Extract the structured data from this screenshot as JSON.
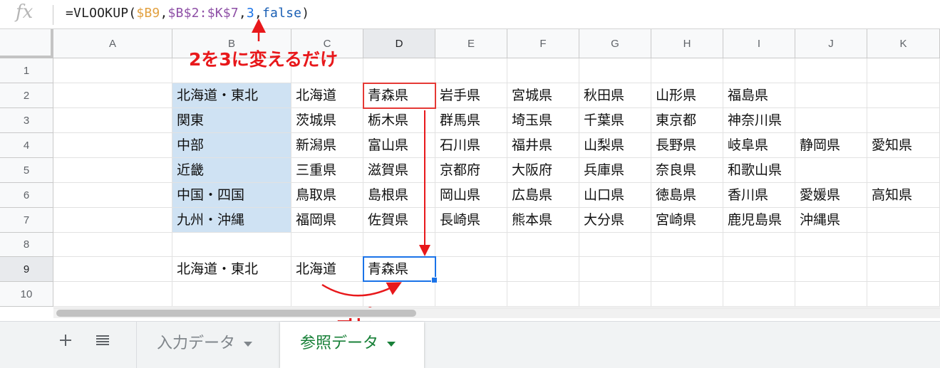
{
  "formula_bar": {
    "fx_icon": "fx",
    "formula_parts": [
      {
        "text": "=VLOOKUP(",
        "color": "#222222"
      },
      {
        "text": "$B9",
        "color": "#e2a03f"
      },
      {
        "text": ",",
        "color": "#222222"
      },
      {
        "text": "$B$2:$K$7",
        "color": "#8e4fa6"
      },
      {
        "text": ",",
        "color": "#222222"
      },
      {
        "text": "3",
        "color": "#1a73e8"
      },
      {
        "text": ",",
        "color": "#222222"
      },
      {
        "text": "false",
        "color": "#1a5fb4"
      },
      {
        "text": ")",
        "color": "#222222"
      }
    ]
  },
  "columns": [
    "A",
    "B",
    "C",
    "D",
    "E",
    "F",
    "G",
    "H",
    "I",
    "J",
    "K"
  ],
  "selected_column": "D",
  "rows": [
    "1",
    "2",
    "3",
    "4",
    "5",
    "6",
    "7",
    "8",
    "9",
    "10"
  ],
  "selected_row": "9",
  "cells": {
    "r2": [
      "",
      "北海道・東北",
      "北海道",
      "青森県",
      "岩手県",
      "宮城県",
      "秋田県",
      "山形県",
      "福島県",
      "",
      ""
    ],
    "r3": [
      "",
      "関東",
      "茨城県",
      "栃木県",
      "群馬県",
      "埼玉県",
      "千葉県",
      "東京都",
      "神奈川県",
      "",
      ""
    ],
    "r4": [
      "",
      "中部",
      "新潟県",
      "富山県",
      "石川県",
      "福井県",
      "山梨県",
      "長野県",
      "岐阜県",
      "静岡県",
      "愛知県"
    ],
    "r5": [
      "",
      "近畿",
      "三重県",
      "滋賀県",
      "京都府",
      "大阪府",
      "兵庫県",
      "奈良県",
      "和歌山県",
      "",
      ""
    ],
    "r6": [
      "",
      "中国・四国",
      "鳥取県",
      "島根県",
      "岡山県",
      "広島県",
      "山口県",
      "徳島県",
      "香川県",
      "愛媛県",
      "高知県"
    ],
    "r7": [
      "",
      "九州・沖縄",
      "福岡県",
      "佐賀県",
      "長崎県",
      "熊本県",
      "大分県",
      "宮崎県",
      "鹿児島県",
      "沖縄県",
      ""
    ],
    "r9": [
      "",
      "北海道・東北",
      "北海道",
      "青森県",
      "",
      "",
      "",
      "",
      "",
      "",
      ""
    ]
  },
  "annotations": {
    "change_note": "2を3に変えるだけ",
    "copy_note": "コピー",
    "accent_color": "#e8181b"
  },
  "sheet_tabs": {
    "add_icon": "plus-icon",
    "list_icon": "list-icon",
    "tabs": [
      {
        "label": "入力データ",
        "active": false
      },
      {
        "label": "参照データ",
        "active": true
      }
    ]
  }
}
